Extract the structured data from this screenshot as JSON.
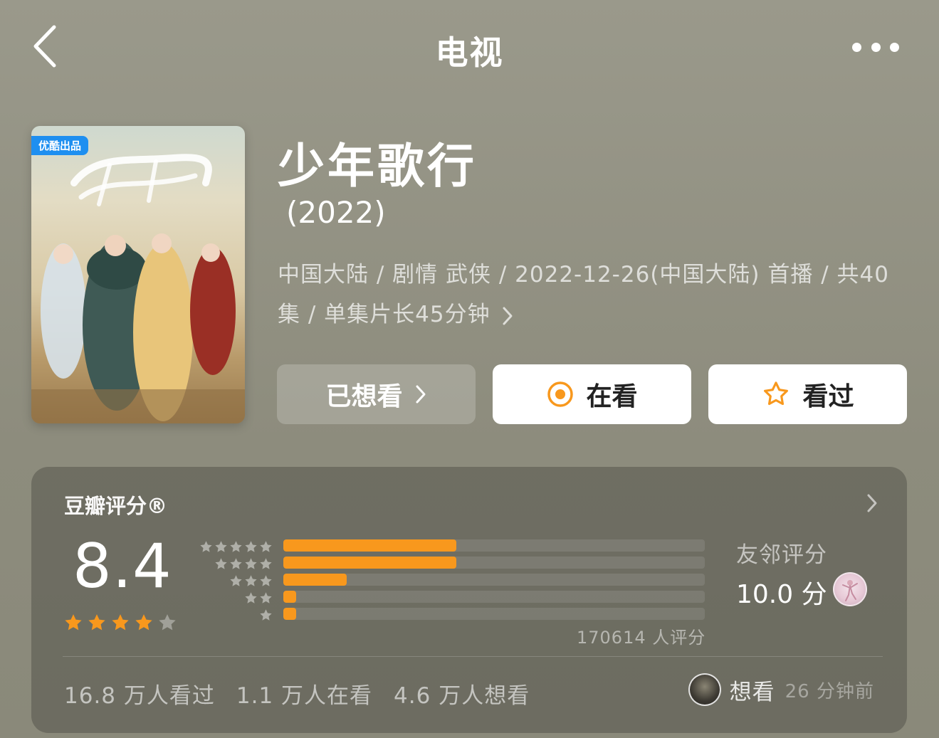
{
  "header": {
    "title": "电视"
  },
  "poster": {
    "badge": "优酷出品"
  },
  "show": {
    "title": "少年歌行",
    "year": "(2022)",
    "meta_line": "中国大陆 / 剧情 武侠 / 2022-12-26(中国大陆) 首播 / 共40集 / 单集片长45分钟"
  },
  "actions": {
    "wish_label": "已想看",
    "doing_label": "在看",
    "done_label": "看过"
  },
  "rating": {
    "label": "豆瓣评分®",
    "score": "8.4",
    "stars_filled": 4,
    "stars_total": 5,
    "distribution": [
      {
        "stars": 5,
        "fraction": 0.41
      },
      {
        "stars": 4,
        "fraction": 0.41
      },
      {
        "stars": 3,
        "fraction": 0.15
      },
      {
        "stars": 2,
        "fraction": 0.03
      },
      {
        "stars": 1,
        "fraction": 0.03
      }
    ],
    "count_text": "170614 人评分",
    "friend_label": "友邻评分",
    "friend_score": "10.0 分"
  },
  "stats": {
    "watched": "16.8 万人看过",
    "watching": "1.1 万人在看",
    "wish": "4.6 万人想看"
  },
  "activity": {
    "action": "想看",
    "time": "26 分钟前"
  },
  "colors": {
    "accent": "#f8981d",
    "badge": "#1e8ff0"
  }
}
